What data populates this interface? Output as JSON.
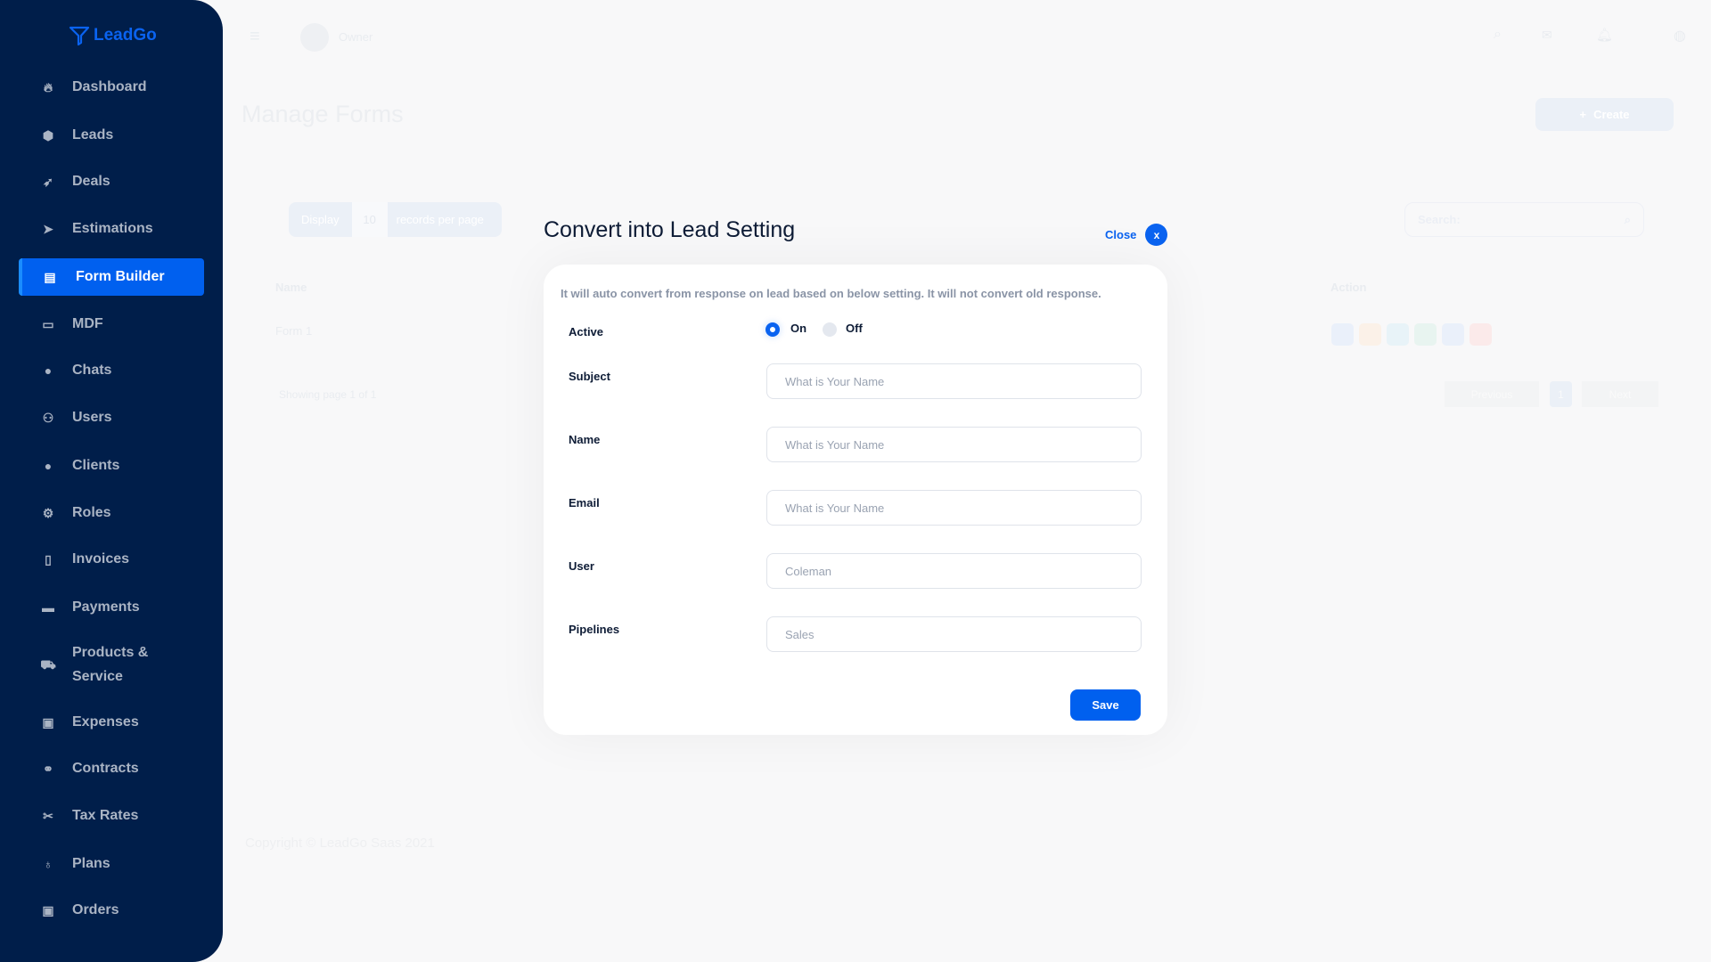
{
  "brand": {
    "name": "LeadGo",
    "color": "#0a63f0"
  },
  "sidebar": {
    "items": [
      {
        "label": "Dashboard",
        "icon": "fire-icon"
      },
      {
        "label": "Leads",
        "icon": "cube-icon"
      },
      {
        "label": "Deals",
        "icon": "rocket-icon"
      },
      {
        "label": "Estimations",
        "icon": "paper-plane-icon"
      },
      {
        "label": "Form Builder",
        "icon": "book-icon",
        "active": true
      },
      {
        "label": "MDF",
        "icon": "money-check-icon"
      },
      {
        "label": "Chats",
        "icon": "comments-icon"
      },
      {
        "label": "Users",
        "icon": "users-icon"
      },
      {
        "label": "Clients",
        "icon": "user-icon"
      },
      {
        "label": "Roles",
        "icon": "user-cog-icon"
      },
      {
        "label": "Invoices",
        "icon": "invoice-icon"
      },
      {
        "label": "Payments",
        "icon": "credit-card-icon"
      },
      {
        "label": "Products & Service",
        "icon": "dolly-icon"
      },
      {
        "label": "Expenses",
        "icon": "money-bill-icon"
      },
      {
        "label": "Contracts",
        "icon": "handshake-icon"
      },
      {
        "label": "Tax Rates",
        "icon": "scissors-icon"
      },
      {
        "label": "Plans",
        "icon": "award-icon"
      },
      {
        "label": "Orders",
        "icon": "money-bill-icon"
      }
    ]
  },
  "header": {
    "user": "Owner"
  },
  "page": {
    "title": "Manage Forms",
    "create_label": "Create",
    "display_label": "Display",
    "per_page": "10",
    "records_label": "records per page",
    "search_placeholder": "Search:",
    "columns": [
      "Name",
      "Action"
    ],
    "rows": [
      {
        "name": "Form 1"
      }
    ],
    "showing": "Showing page 1 of 1",
    "prev": "Previous",
    "page": "1",
    "next": "Next",
    "copyright": "Copyright © LeadGo Saas 2021"
  },
  "modal": {
    "title": "Convert into Lead Setting",
    "close_label": "Close",
    "close_icon": "x",
    "description": "It will auto convert from response on lead based on below setting. It will not convert old response.",
    "active": {
      "label": "Active",
      "options": [
        "On",
        "Off"
      ],
      "selected": "On"
    },
    "fields": [
      {
        "label": "Subject",
        "placeholder": "What is Your Name",
        "value": ""
      },
      {
        "label": "Name",
        "placeholder": "What is Your Name",
        "value": ""
      },
      {
        "label": "Email",
        "placeholder": "What is Your Name",
        "value": ""
      },
      {
        "label": "User",
        "placeholder": "",
        "value": "Coleman"
      },
      {
        "label": "Pipelines",
        "placeholder": "",
        "value": "Sales"
      }
    ],
    "save_label": "Save"
  }
}
